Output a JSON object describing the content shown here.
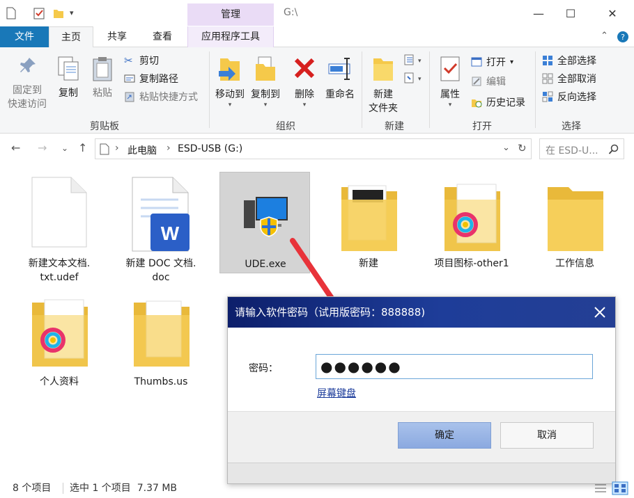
{
  "window": {
    "context_tab_header": "管理",
    "path_title": "G:\\",
    "minimize": "—",
    "maximize": "☐",
    "close": "✕"
  },
  "tabs": {
    "file": "文件",
    "home": "主页",
    "share": "共享",
    "view": "查看",
    "app_tools": "应用程序工具"
  },
  "ribbon": {
    "clipboard": {
      "pin": "固定到\n快速访问",
      "copy": "复制",
      "paste": "粘贴",
      "cut": "剪切",
      "copy_path": "复制路径",
      "paste_shortcut": "粘贴快捷方式",
      "label": "剪贴板"
    },
    "organize": {
      "move_to": "移动到",
      "copy_to": "复制到",
      "delete": "删除",
      "rename": "重命名",
      "label": "组织"
    },
    "new": {
      "new_folder": "新建\n文件夹",
      "label": "新建"
    },
    "open": {
      "properties": "属性",
      "open": "打开",
      "edit": "编辑",
      "history": "历史记录",
      "label": "打开"
    },
    "select": {
      "select_all": "全部选择",
      "select_none": "全部取消",
      "invert": "反向选择",
      "label": "选择"
    }
  },
  "address": {
    "this_pc": "此电脑",
    "drive": "ESD-USB (G:)",
    "search_placeholder": "在 ESD-U..."
  },
  "files": [
    {
      "name": "新建文本文档.\ntxt.udef",
      "icon": "text-file-icon"
    },
    {
      "name": "新建 DOC 文档.\ndoc",
      "icon": "word-doc-icon"
    },
    {
      "name": "UDE.exe",
      "icon": "exe-icon",
      "selected": true
    },
    {
      "name": "新建",
      "icon": "folder-icon"
    },
    {
      "name": "项目图标-other1",
      "icon": "folder-icon"
    },
    {
      "name": "工作信息",
      "icon": "folder-icon"
    },
    {
      "name": "个人资料",
      "icon": "folder-icon"
    },
    {
      "name": "Thumbs.us",
      "icon": "folder-icon"
    }
  ],
  "status": {
    "count": "8 个项目",
    "selected": "选中 1 个项目  7.37 MB"
  },
  "dialog": {
    "title": "请输入软件密码（试用版密码：888888)",
    "password_label": "密码：",
    "password_value": "●●●●●●",
    "keyboard_link": "屏幕键盘",
    "ok": "确定",
    "cancel": "取消"
  },
  "colors": {
    "accent": "#1978b8",
    "dialog_title_bg": "#1e3d99",
    "context_tab": "#eadcf6",
    "selection": "#cce8ff",
    "arrow": "#e8333a"
  }
}
